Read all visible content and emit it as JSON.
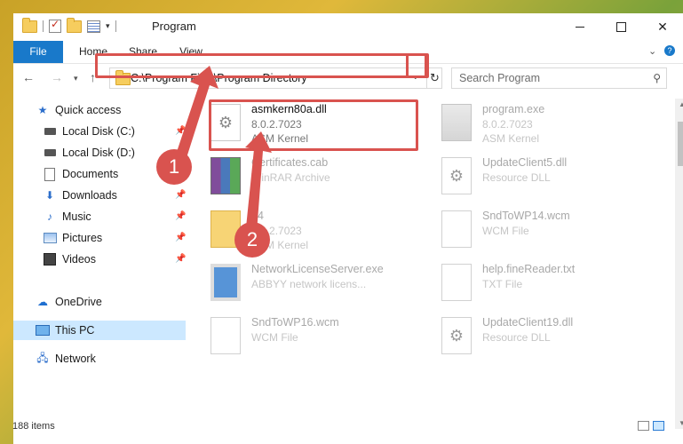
{
  "window": {
    "title": "Program"
  },
  "ribbon": {
    "tabs": [
      "File",
      "Home",
      "Share",
      "View"
    ],
    "help": "?"
  },
  "address": {
    "path": "C:\\Program Files\\Program Directory",
    "refresh": "↻"
  },
  "search": {
    "placeholder": "Search Program"
  },
  "sidebar": {
    "items": [
      {
        "label": "Quick access",
        "icon": "star-icon"
      },
      {
        "label": "Local Disk (C:)",
        "icon": "disk-icon",
        "pinned": true
      },
      {
        "label": "Local Disk (D:)",
        "icon": "disk-icon"
      },
      {
        "label": "Documents",
        "icon": "documents-icon",
        "pinned": true
      },
      {
        "label": "Downloads",
        "icon": "download-icon",
        "pinned": true
      },
      {
        "label": "Music",
        "icon": "music-icon",
        "pinned": true
      },
      {
        "label": "Pictures",
        "icon": "pictures-icon",
        "pinned": true
      },
      {
        "label": "Videos",
        "icon": "videos-icon",
        "pinned": true
      },
      {
        "label": "OneDrive",
        "icon": "cloud-icon"
      },
      {
        "label": "This PC",
        "icon": "computer-icon",
        "selected": true
      },
      {
        "label": "Network",
        "icon": "network-icon"
      }
    ]
  },
  "files": [
    {
      "name": "asmkern80a.dll",
      "version": "8.0.2.7023",
      "desc": "ASM Kernel",
      "icon": "dll"
    },
    {
      "name": "program.exe",
      "version": "8.0.2.7023",
      "desc": "ASM Kernel",
      "icon": "exe"
    },
    {
      "name": "Certificates.cab",
      "version": "",
      "desc": "WinRAR Archive",
      "icon": "rar"
    },
    {
      "name": "UpdateClient5.dll",
      "version": "",
      "desc": "Resource DLL",
      "icon": "dll"
    },
    {
      "name": "64",
      "version": "8.0.2.7023",
      "desc": "ASM Kernel",
      "icon": "folder"
    },
    {
      "name": "SndToWP14.wcm",
      "version": "",
      "desc": "WCM File",
      "icon": "page"
    },
    {
      "name": "NetworkLicenseServer.exe",
      "version": "",
      "desc": "ABBYY network licens...",
      "icon": "netexe"
    },
    {
      "name": "help.fineReader.txt",
      "version": "",
      "desc": "TXT File",
      "icon": "page"
    },
    {
      "name": "SndToWP16.wcm",
      "version": "",
      "desc": "WCM File",
      "icon": "page"
    },
    {
      "name": "UpdateClient19.dll",
      "version": "",
      "desc": "Resource DLL",
      "icon": "dll"
    }
  ],
  "status": {
    "items": "188 items"
  },
  "annotations": {
    "step1": "1",
    "step2": "2"
  },
  "colors": {
    "accent": "#1979ca",
    "highlight": "#d9534f",
    "selected": "#cce8ff"
  }
}
